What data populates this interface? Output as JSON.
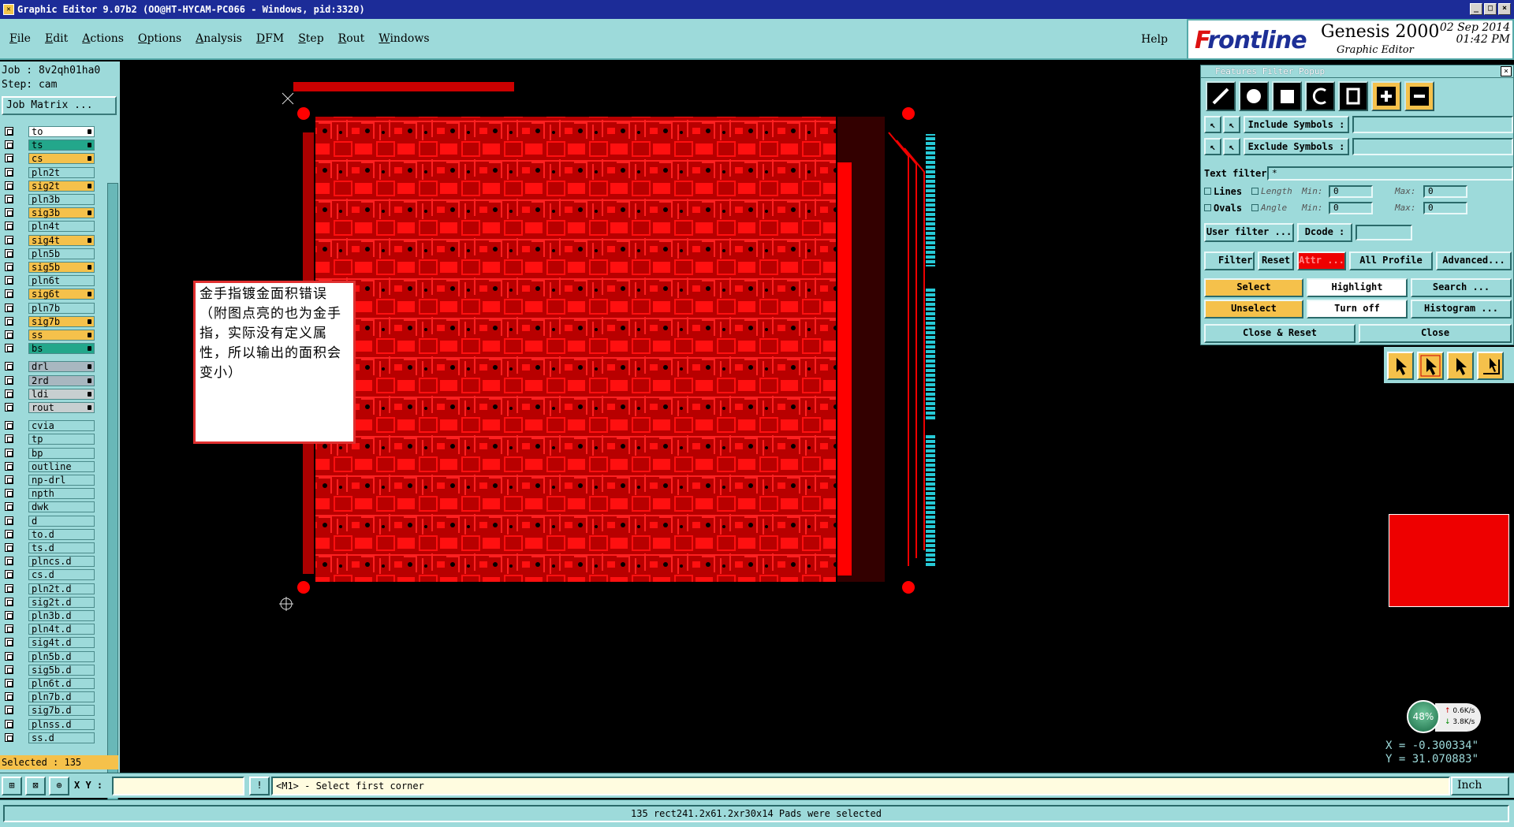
{
  "window": {
    "title": "Graphic Editor 9.07b2 (OO@HT-HYCAM-PC066 - Windows, pid:3320)",
    "buttons": [
      "_",
      "□",
      "×"
    ]
  },
  "menu": {
    "items": [
      "File",
      "Edit",
      "Actions",
      "Options",
      "Analysis",
      "DFM",
      "Step",
      "Rout",
      "Windows"
    ],
    "help": "Help"
  },
  "logo": {
    "brand_prefix": "F",
    "brand_rest": "rontline",
    "product": "Genesis 2000",
    "subtitle": "Graphic Editor",
    "date": "02 Sep 2014",
    "time": "01:42 PM"
  },
  "left_panel": {
    "job": "Job : 8v2qh01ha0",
    "step": "Step: cam",
    "job_matrix": "Job Matrix ...",
    "selected": "Selected : 135",
    "layers": [
      {
        "name": "to",
        "style": "wh"
      },
      {
        "name": "ts",
        "style": "gr"
      },
      {
        "name": "cs",
        "style": "sig"
      },
      {
        "name": "pln2t",
        "style": "plain"
      },
      {
        "name": "sig2t",
        "style": "sig"
      },
      {
        "name": "pln3b",
        "style": "plain"
      },
      {
        "name": "sig3b",
        "style": "sig"
      },
      {
        "name": "pln4t",
        "style": "plain"
      },
      {
        "name": "sig4t",
        "style": "sig"
      },
      {
        "name": "pln5b",
        "style": "plain"
      },
      {
        "name": "sig5b",
        "style": "sig"
      },
      {
        "name": "pln6t",
        "style": "plain"
      },
      {
        "name": "sig6t",
        "style": "sig"
      },
      {
        "name": "pln7b",
        "style": "plain"
      },
      {
        "name": "sig7b",
        "style": "sig"
      },
      {
        "name": "ss",
        "style": "sig"
      },
      {
        "name": "bs",
        "style": "gr"
      },
      {
        "name": "drl",
        "style": "gy2"
      },
      {
        "name": "2rd",
        "style": "gy2"
      },
      {
        "name": "ldi",
        "style": "gy"
      },
      {
        "name": "rout",
        "style": "gy"
      },
      {
        "name": "cvia",
        "style": "plain"
      },
      {
        "name": "tp",
        "style": "plain"
      },
      {
        "name": "bp",
        "style": "plain"
      },
      {
        "name": "outline",
        "style": "plain"
      },
      {
        "name": "np-drl",
        "style": "plain"
      },
      {
        "name": "npth",
        "style": "plain"
      },
      {
        "name": "dwk",
        "style": "plain"
      },
      {
        "name": "d",
        "style": "plain"
      },
      {
        "name": "to.d",
        "style": "plain"
      },
      {
        "name": "ts.d",
        "style": "plain"
      },
      {
        "name": "plncs.d",
        "style": "plain"
      },
      {
        "name": "cs.d",
        "style": "plain"
      },
      {
        "name": "pln2t.d",
        "style": "plain"
      },
      {
        "name": "sig2t.d",
        "style": "plain"
      },
      {
        "name": "pln3b.d",
        "style": "plain"
      },
      {
        "name": "pln4t.d",
        "style": "plain"
      },
      {
        "name": "sig4t.d",
        "style": "plain"
      },
      {
        "name": "pln5b.d",
        "style": "plain"
      },
      {
        "name": "sig5b.d",
        "style": "plain"
      },
      {
        "name": "pln6t.d",
        "style": "plain"
      },
      {
        "name": "pln7b.d",
        "style": "plain"
      },
      {
        "name": "sig7b.d",
        "style": "plain"
      },
      {
        "name": "plnss.d",
        "style": "plain"
      },
      {
        "name": "ss.d",
        "style": "plain"
      }
    ]
  },
  "annotation": {
    "text": "金手指镀金面积错误（附图点亮的也为金手指，实际没有定义属性，所以输出的面积会变小）"
  },
  "filter_popup": {
    "title": "Features Filter Popup",
    "include_symbols": "Include Symbols :",
    "exclude_symbols": "Exclude Symbols :",
    "text_filter": "Text filter",
    "text_filter_value": "*",
    "lines": "Lines",
    "ovals": "Ovals",
    "length": "Length",
    "angle": "Angle",
    "min": "Min:",
    "max": "Max:",
    "lines_min": "0",
    "lines_max": "0",
    "ovals_min": "0",
    "ovals_max": "0",
    "user_filter": "User filter ...",
    "dcode": "Dcode :",
    "filter": "Filter",
    "reset": "Reset",
    "attr": "Attr ...",
    "all_profile": "All Profile",
    "advanced": "Advanced...",
    "select": "Select",
    "highlight": "Highlight",
    "search": "Search ...",
    "unselect": "Unselect",
    "turn_off": "Turn off",
    "histogram": "Histogram ...",
    "close_reset": "Close & Reset",
    "close": "Close"
  },
  "net_monitor": {
    "percent": "48%",
    "up": "0.6K/s",
    "down": "3.8K/s"
  },
  "coords": {
    "x": "X = -0.300334\"",
    "y": "Y = 31.070883\""
  },
  "command_bar": {
    "xy_label": "X Y :",
    "prompt": "<M1> - Select first corner",
    "units": "Inch"
  },
  "status": "135 rect241.2x61.2xr30x14 Pads were selected",
  "colors": {
    "panel": "#9ddada",
    "signal_layer": "#f5c14b",
    "copper": "#e00000",
    "titlebar": "#1c2c98"
  }
}
